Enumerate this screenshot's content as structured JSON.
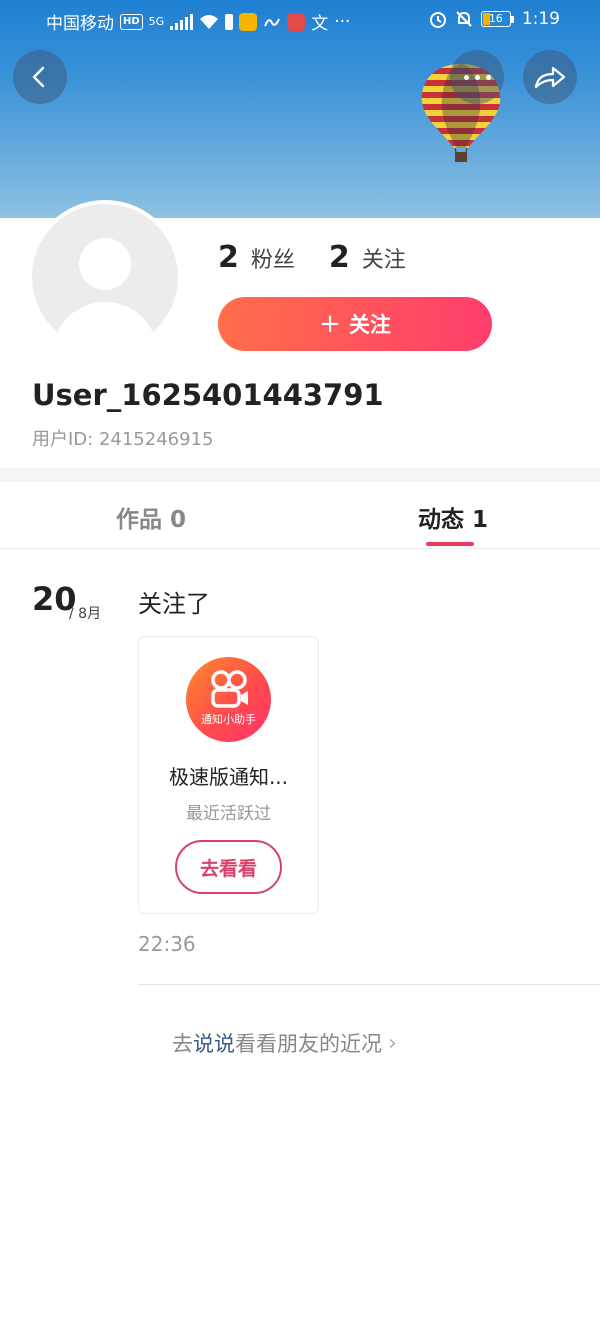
{
  "status_bar": {
    "carrier": "中国移动",
    "hd": "HD",
    "network": "5G",
    "battery_level": "16",
    "time": "1:19"
  },
  "header": {
    "back_icon": "back-arrow-icon",
    "more_icon": "more-dots-icon",
    "share_icon": "share-arrow-icon"
  },
  "profile": {
    "followers_count": "2",
    "followers_label": "粉丝",
    "following_count": "2",
    "following_label": "关注",
    "follow_button_plus": "+",
    "follow_button_label": "关注",
    "username": "User_1625401443791",
    "user_id": "用户ID: 2415246915"
  },
  "tabs": [
    {
      "label": "作品 0",
      "active": false
    },
    {
      "label": "动态 1",
      "active": true
    }
  ],
  "feed": {
    "date_day": "20",
    "date_month": "/ 8月",
    "action": "关注了",
    "card": {
      "logo_text": "通知小助手",
      "title": "极速版通知...",
      "subtitle": "最近活跃过",
      "button_label": "去看看"
    },
    "time": "22:36"
  },
  "bottom_link": {
    "prefix": "去",
    "highlight": "说说",
    "suffix": "看看朋友的近况"
  },
  "colors": {
    "accent": "#ea3a5f",
    "follow_gradient_start": "#ff6e4a",
    "follow_gradient_end": "#ff3d6c",
    "banner_sky": "#3a92d8"
  }
}
